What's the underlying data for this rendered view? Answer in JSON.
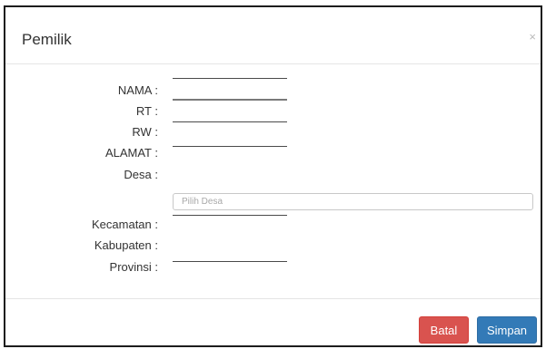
{
  "modal": {
    "title": "Pemilik",
    "close_symbol": "×",
    "close_icon": "close-icon"
  },
  "form": {
    "fields": {
      "nama": {
        "label": "NAMA :",
        "value": ""
      },
      "rt": {
        "label": "RT :",
        "value": ""
      },
      "rw": {
        "label": "RW :",
        "value": ""
      },
      "alamat": {
        "label": "ALAMAT :",
        "value": ""
      },
      "desa": {
        "label": "Desa :",
        "placeholder": "Pilih Desa"
      },
      "kecamatan": {
        "label": "Kecamatan :",
        "value": ""
      },
      "kabupaten": {
        "label": "Kabupaten :",
        "value": ""
      },
      "provinsi": {
        "label": "Provinsi :",
        "value": ""
      }
    }
  },
  "footer": {
    "cancel_label": "Batal",
    "save_label": "Simpan"
  },
  "colors": {
    "cancel": "#d9534f",
    "save": "#337ab7"
  }
}
